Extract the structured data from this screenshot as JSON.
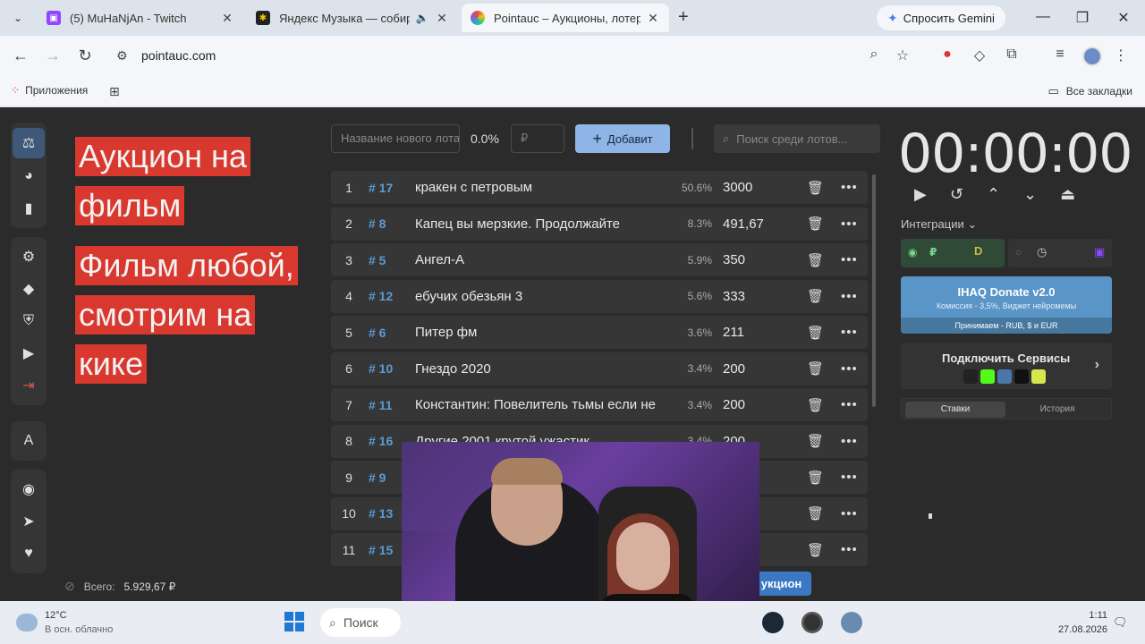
{
  "browser": {
    "tabs": [
      {
        "title": "(5) MuHaNjAn - Twitch",
        "favicon_color": "#9146ff"
      },
      {
        "title": "Яндекс Музыка — собира",
        "favicon_color": "#222222"
      },
      {
        "title": "Pointauc – Аукционы, лотереи",
        "favicon_color": "#e8e8e8"
      }
    ],
    "gemini_label": "Спросить Gemini",
    "url": "pointauc.com",
    "bookmarks_apps": "Приложения",
    "bookmarks_all": "Все закладки",
    "extension_badge": "1"
  },
  "app": {
    "headline_lines": [
      "Аукцион на",
      "фильм",
      "Фильм любой,",
      "смотрим на",
      "кике"
    ],
    "name_placeholder": "Название нового лота",
    "percent": "0.0%",
    "rub_placeholder": "₽",
    "add_label": "Добавит",
    "search_placeholder": "Поиск среди лотов...",
    "lots": [
      {
        "num": "1",
        "id": "# 17",
        "name": "кракен с петровым",
        "pct": "50.6%",
        "val": "3000"
      },
      {
        "num": "2",
        "id": "# 8",
        "name": "Капец вы мерзкие. Продолжайте",
        "pct": "8.3%",
        "val": "491,67"
      },
      {
        "num": "3",
        "id": "# 5",
        "name": " Ангел-А",
        "pct": "5.9%",
        "val": "350"
      },
      {
        "num": "4",
        "id": "# 12",
        "name": "ебучих обезьян 3",
        "pct": "5.6%",
        "val": "333"
      },
      {
        "num": "5",
        "id": "# 6",
        "name": "Питер фм",
        "pct": "3.6%",
        "val": "211"
      },
      {
        "num": "6",
        "id": "# 10",
        "name": "Гнездо 2020",
        "pct": "3.4%",
        "val": "200"
      },
      {
        "num": "7",
        "id": "# 11",
        "name": "Константин: Повелитель тьмы если не",
        "pct": "3.4%",
        "val": "200"
      },
      {
        "num": "8",
        "id": "# 16",
        "name": "Другие 2001 крутой ужастик",
        "pct": "3.4%",
        "val": "200"
      },
      {
        "num": "9",
        "id": "# 9",
        "name": "",
        "pct": "",
        "val": ""
      },
      {
        "num": "10",
        "id": "# 13",
        "name": "",
        "pct": "",
        "val": ""
      },
      {
        "num": "11",
        "id": "# 15",
        "name": "",
        "pct": "",
        "val": ""
      }
    ],
    "total_label": "Всего:",
    "total_value": "5.929,67 ₽",
    "auction_button": "укцион",
    "timer": "00:00:00",
    "integrations_label": "Интеграции",
    "ihaq_title": "IHAQ Donate v2.0",
    "ihaq_commission": "Комиссия - 3,5%, Виджет нейромемы",
    "ihaq_accept": "Принимаем - RUB, $ и EUR",
    "connect_label": "Подключить Сервисы",
    "tab_bets": "Ставки",
    "tab_history": "История"
  },
  "taskbar": {
    "temp": "12°C",
    "weather": "В осн. облачно",
    "search": "Поиск",
    "time": "1:11",
    "date": "27.08.2026"
  }
}
